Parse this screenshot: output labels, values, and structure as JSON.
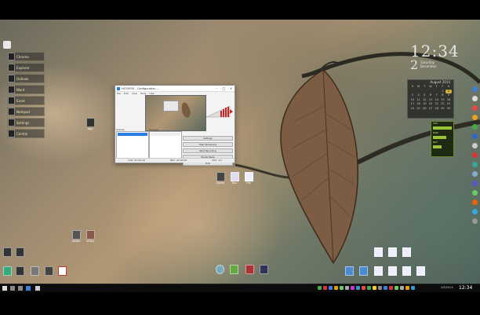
{
  "clock": {
    "time": "12:34",
    "day": "2",
    "sub": "Saturday\nDecember"
  },
  "calendar": {
    "header": "August 2014",
    "days": [
      "S",
      "M",
      "T",
      "W",
      "T",
      "F",
      "S"
    ],
    "cells": [
      "",
      "",
      "",
      "",
      "",
      "1",
      "2",
      "3",
      "4",
      "5",
      "6",
      "7",
      "8",
      "9",
      "10",
      "11",
      "12",
      "13",
      "14",
      "15",
      "16",
      "17",
      "18",
      "19",
      "20",
      "21",
      "22",
      "23",
      "24",
      "25",
      "26",
      "27",
      "28",
      "29",
      "30"
    ],
    "today": "2"
  },
  "window": {
    "title": "HOTKEYS - Configuration ...",
    "menu": [
      "File",
      "Edit",
      "View",
      "Tools",
      "Help"
    ],
    "left_header": "Scenes",
    "middle_header": "Sources",
    "scene_item": "Scene",
    "source_item": "Display",
    "buttons": [
      "Settings",
      "Start Streaming",
      "Start Recording",
      "Studio Mode",
      "Exit"
    ],
    "status": [
      "LIVE: 00:00:00",
      "REC: 00:00:00",
      "CPU: 2%"
    ]
  },
  "launcher": {
    "items": [
      "Chrome",
      "Explorer",
      "Outlook",
      "Word",
      "Excel",
      "Notepad",
      "Settings",
      "Control"
    ]
  },
  "desktop_icons": [
    "Recycle",
    "App",
    "Game",
    "Doc",
    "File",
    "Media",
    "Video"
  ],
  "sysmon_labels": [
    "CPU",
    "RAM",
    "NET"
  ],
  "taskbar": {
    "time": "12:34",
    "date": "2/8/2014"
  }
}
